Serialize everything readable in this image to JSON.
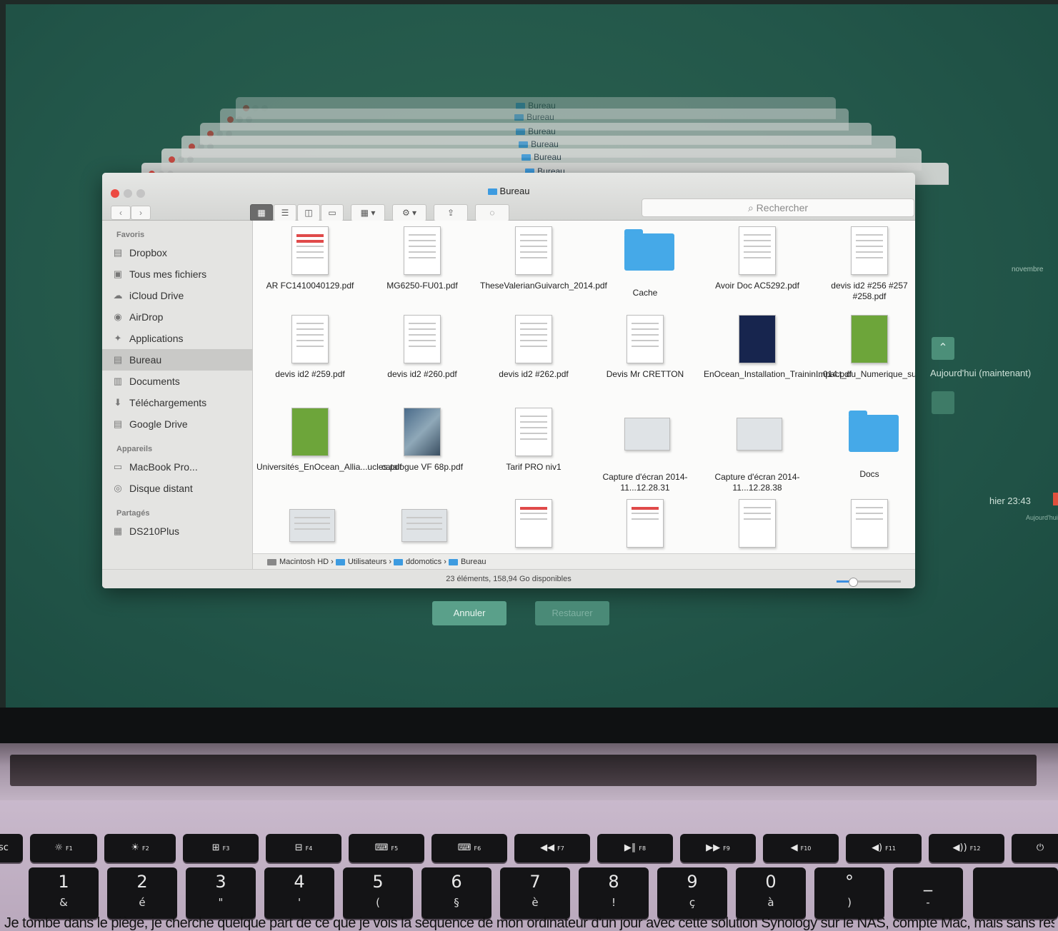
{
  "finder": {
    "window_title": "Bureau",
    "stack_titles": [
      "Bureau",
      "Bureau",
      "Bureau",
      "Bureau",
      "Bureau",
      "Bureau"
    ],
    "nav_back": "‹",
    "nav_forward": "›",
    "search_placeholder": "Rechercher",
    "sidebar": {
      "favoris_header": "Favoris",
      "favoris": [
        {
          "label": "Dropbox",
          "icon": "folder-icon"
        },
        {
          "label": "Tous mes fichiers",
          "icon": "all-files-icon"
        },
        {
          "label": "iCloud Drive",
          "icon": "cloud-icon"
        },
        {
          "label": "AirDrop",
          "icon": "airdrop-icon"
        },
        {
          "label": "Applications",
          "icon": "applications-icon"
        },
        {
          "label": "Bureau",
          "icon": "desktop-folder-icon",
          "selected": true
        },
        {
          "label": "Documents",
          "icon": "documents-icon"
        },
        {
          "label": "Téléchargements",
          "icon": "download-icon"
        },
        {
          "label": "Google Drive",
          "icon": "folder-icon"
        }
      ],
      "appareils_header": "Appareils",
      "appareils": [
        {
          "label": "MacBook Pro...",
          "icon": "laptop-icon"
        },
        {
          "label": "Disque distant",
          "icon": "disc-icon"
        }
      ],
      "partages_header": "Partagés",
      "partages": [
        {
          "label": "DS210Plus",
          "icon": "server-icon"
        }
      ]
    },
    "files": [
      {
        "name": "AR FC1410040129.pdf",
        "kind": "pdf-red"
      },
      {
        "name": "MG6250-FU01.pdf",
        "kind": "doc"
      },
      {
        "name": "TheseValerianGuivarch_2014.pdf",
        "kind": "doc"
      },
      {
        "name": "Cache",
        "kind": "folder"
      },
      {
        "name": "Avoir Doc AC5292.pdf",
        "kind": "doc"
      },
      {
        "name": "devis id2 #256 #257 #258.pdf",
        "kind": "doc"
      },
      {
        "name": "devis id2 #259.pdf",
        "kind": "doc"
      },
      {
        "name": "devis id2 #260.pdf",
        "kind": "doc"
      },
      {
        "name": "devis id2 #262.pdf",
        "kind": "doc"
      },
      {
        "name": "Devis Mr CRETTON",
        "kind": "pdf"
      },
      {
        "name": "EnOcean_Installation_Trainin...014.pdf",
        "kind": "dark"
      },
      {
        "name": "Impact_du_Numerique_sur...iques.pdf",
        "kind": "green"
      },
      {
        "name": "Universités_EnOcean_Allia...ucles.pdf",
        "kind": "green"
      },
      {
        "name": "catalogue VF 68p.pdf",
        "kind": "photo"
      },
      {
        "name": "Tarif PRO niv1",
        "kind": "xls"
      },
      {
        "name": "Capture d'écran 2014-11...12.28.31",
        "kind": "shot"
      },
      {
        "name": "Capture d'écran 2014-11...12.28.38",
        "kind": "shot"
      },
      {
        "name": "Docs",
        "kind": "folder"
      }
    ],
    "path": [
      "Macintosh HD",
      "Utilisateurs",
      "ddomotics",
      "Bureau"
    ],
    "status": "23 éléments, 158,94 Go disponibles",
    "icon_size_level": 0.25
  },
  "timemachine": {
    "cancel_label": "Annuler",
    "restore_label": "Restaurer",
    "month_label": "novembre",
    "now_label": "Aujourd'hui (maintenant)",
    "hier_label": "hier 23:43",
    "aujourd_label": "Aujourd'hui"
  },
  "keyboard": {
    "fkeys": [
      {
        "sym": "esc",
        "fn": ""
      },
      {
        "sym": "☼",
        "fn": "F1"
      },
      {
        "sym": "☀",
        "fn": "F2"
      },
      {
        "sym": "⊞",
        "fn": "F3"
      },
      {
        "sym": "⊟",
        "fn": "F4"
      },
      {
        "sym": "⌨",
        "fn": "F5"
      },
      {
        "sym": "⌨",
        "fn": "F6"
      },
      {
        "sym": "◀◀",
        "fn": "F7"
      },
      {
        "sym": "▶∥",
        "fn": "F8"
      },
      {
        "sym": "▶▶",
        "fn": "F9"
      },
      {
        "sym": "◀",
        "fn": "F10"
      },
      {
        "sym": "◀)",
        "fn": "F11"
      },
      {
        "sym": "◀))",
        "fn": "F12"
      },
      {
        "sym": "⏻",
        "fn": ""
      }
    ],
    "numkeys": [
      {
        "upper": "1",
        "lower": "&"
      },
      {
        "upper": "2",
        "lower": "é"
      },
      {
        "upper": "3",
        "lower": "\""
      },
      {
        "upper": "4",
        "lower": "'"
      },
      {
        "upper": "5",
        "lower": "("
      },
      {
        "upper": "6",
        "lower": "§"
      },
      {
        "upper": "7",
        "lower": "è"
      },
      {
        "upper": "8",
        "lower": "!"
      },
      {
        "upper": "9",
        "lower": "ç"
      },
      {
        "upper": "0",
        "lower": "à"
      },
      {
        "upper": "°",
        "lower": ")"
      },
      {
        "upper": "_",
        "lower": "-"
      }
    ]
  },
  "caption": "Je tombe dans le piège, je cherche quelque part de ce que je vois la séquence de mon ordinateur d'un jour avec cette solution Synology sur le NAS, compte Mac, mais sans résultat, de nouveau"
}
